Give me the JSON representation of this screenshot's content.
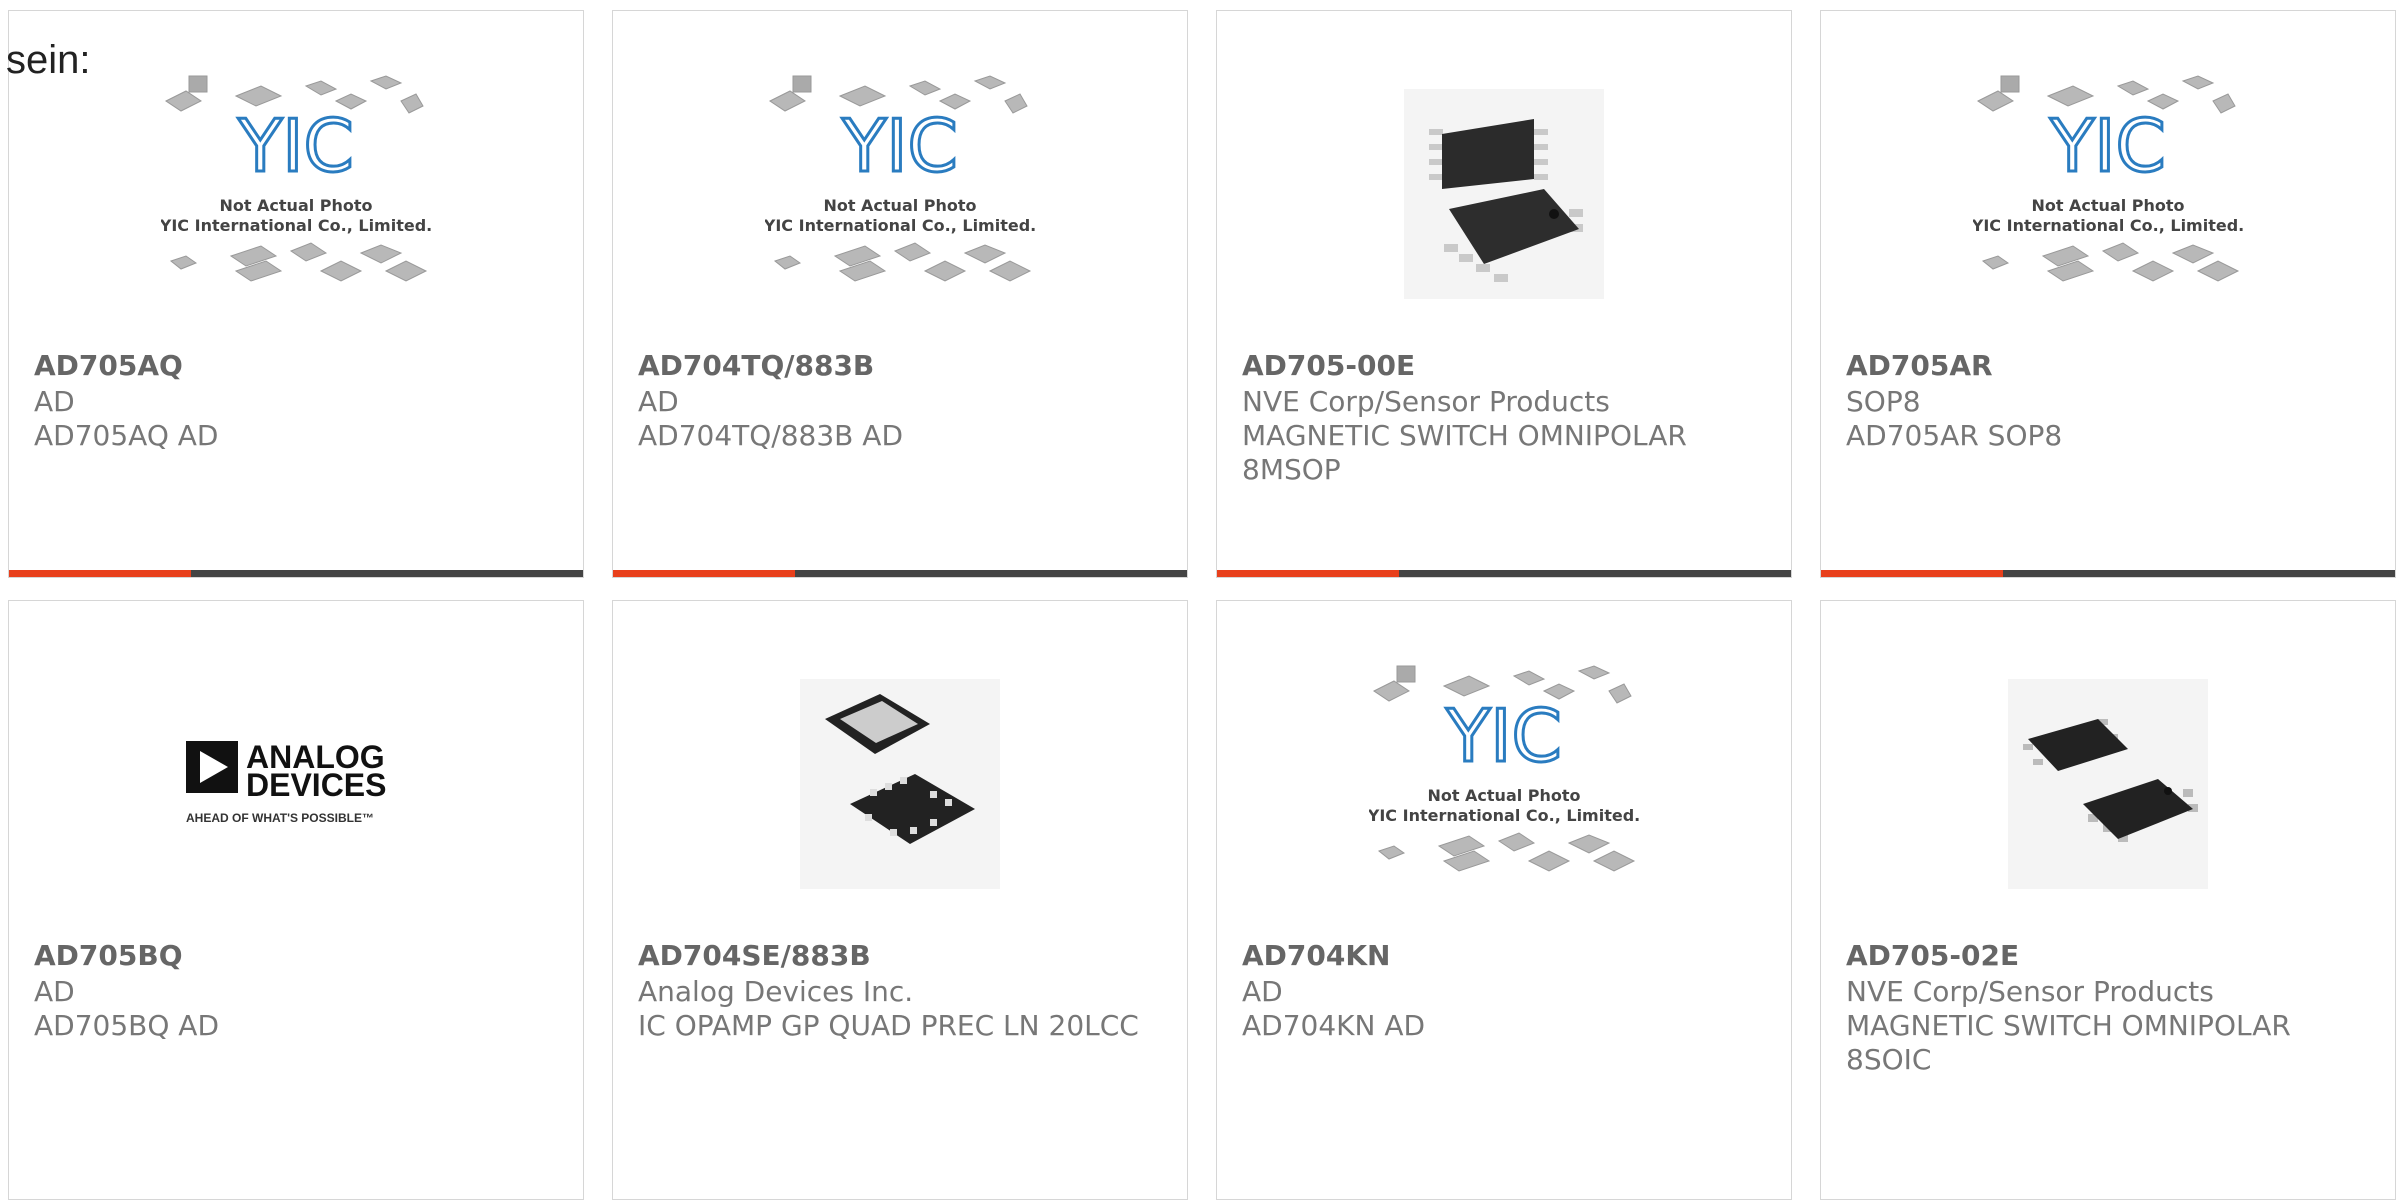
{
  "lead_text": "sein:",
  "placeholder": {
    "line1": "Not Actual Photo",
    "line2": "YIC International Co., Limited.",
    "logo": "YIC"
  },
  "adi_logo": {
    "line1": "ANALOG",
    "line2": "DEVICES",
    "tagline": "AHEAD OF WHAT'S POSSIBLE™"
  },
  "products": [
    {
      "part": "AD705AQ",
      "maker": "AD",
      "desc": "AD705AQ AD",
      "image": "placeholder",
      "accent": "#e8401c"
    },
    {
      "part": "AD704TQ/883B",
      "maker": "AD",
      "desc": "AD704TQ/883B AD",
      "image": "placeholder",
      "accent": "#e8401c"
    },
    {
      "part": "AD705-00E",
      "maker": "NVE Corp/Sensor Products",
      "desc": "MAGNETIC SWITCH OMNIPOLAR 8MSOP",
      "image": "msop-chip",
      "accent": "#e8401c"
    },
    {
      "part": "AD705AR",
      "maker": "SOP8",
      "desc": "AD705AR SOP8",
      "image": "placeholder",
      "accent": "#e8401c"
    },
    {
      "part": "AD705BQ",
      "maker": "AD",
      "desc": "AD705BQ AD",
      "image": "analog-devices-logo"
    },
    {
      "part": "AD704SE/883B",
      "maker": "Analog Devices Inc.",
      "desc": "IC OPAMP GP QUAD PREC LN 20LCC",
      "image": "lcc-chip"
    },
    {
      "part": "AD704KN",
      "maker": "AD",
      "desc": "AD704KN AD",
      "image": "placeholder"
    },
    {
      "part": "AD705-02E",
      "maker": "NVE Corp/Sensor Products",
      "desc": "MAGNETIC SWITCH OMNIPOLAR 8SOIC",
      "image": "soic-chip"
    }
  ]
}
